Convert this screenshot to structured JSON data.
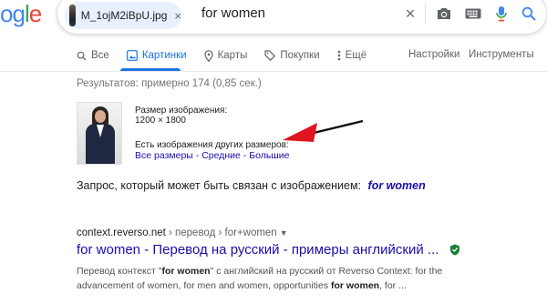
{
  "header": {
    "logo_parts": [
      "o",
      "g",
      "l",
      "e"
    ],
    "image_chip": {
      "filename": "M_1ojM2iBpU.jpg",
      "close": "×"
    },
    "query": "for women",
    "clear": "×"
  },
  "tabs": [
    {
      "label": "Все",
      "icon": "search-icon",
      "active": false
    },
    {
      "label": "Картинки",
      "icon": "image-icon",
      "active": true
    },
    {
      "label": "Карты",
      "icon": "map-pin-icon",
      "active": false
    },
    {
      "label": "Покупки",
      "icon": "tag-icon",
      "active": false
    },
    {
      "label": "Ещё",
      "icon": "more-icon",
      "active": false
    }
  ],
  "tab_right": {
    "settings": "Настройки",
    "tools": "Инструменты"
  },
  "result_stats": "Результатов: примерно 174 (0,85 сек.)",
  "image_info": {
    "size_label": "Размер изображения:",
    "size_value": "1200 × 1800",
    "other_sizes": "Есть изображения других размеров:",
    "link_all": "Все размеры",
    "link_medium": "Средние",
    "link_large": "Большие",
    "separator": " - "
  },
  "related_query": {
    "label": "Запрос, который может быть связан с изображением:",
    "query": "for women"
  },
  "result": {
    "domain": "context.reverso.net",
    "path": " › перевод › for+women",
    "title": "for women - Перевод на русский - примеры английский ...",
    "snippet_line1_a": "Перевод контекст \"",
    "snippet_line1_b": "for women",
    "snippet_line1_c": "\" с английский на русский от Reverso Context: for the",
    "snippet_line2_a": "advancement of women, for men and women, opportunities ",
    "snippet_line2_b": "for women",
    "snippet_line2_c": ", for ..."
  },
  "colors": {
    "link": "#1a0dab",
    "active_tab": "#1a73e8",
    "arrow": "#e0141e",
    "verified": "#188038"
  }
}
